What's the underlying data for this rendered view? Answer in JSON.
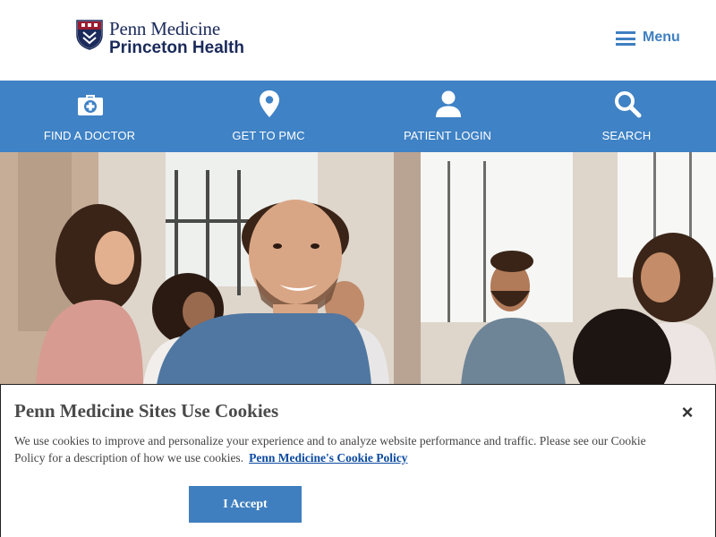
{
  "header": {
    "logo_line1": "Penn Medicine",
    "logo_line2": "Princeton Health",
    "menu_label": "Menu"
  },
  "nav": {
    "items": [
      {
        "label": "FIND A DOCTOR",
        "icon": "medical-bag-icon"
      },
      {
        "label": "GET TO PMC",
        "icon": "map-pin-icon"
      },
      {
        "label": "PATIENT LOGIN",
        "icon": "person-icon"
      },
      {
        "label": "SEARCH",
        "icon": "search-icon"
      }
    ]
  },
  "hero": {
    "description": "group-photo"
  },
  "cookie": {
    "title": "Penn Medicine Sites Use Cookies",
    "text": "We use cookies to improve and personalize your experience and to analyze website performance and traffic. Please see our Cookie Policy for a description of how we use cookies.",
    "link": "Penn Medicine's Cookie Policy",
    "accept": "I Accept",
    "close": "×"
  },
  "colors": {
    "brand_blue": "#3f82c5",
    "navy": "#1a2a5a",
    "link": "#0b4aa0"
  }
}
